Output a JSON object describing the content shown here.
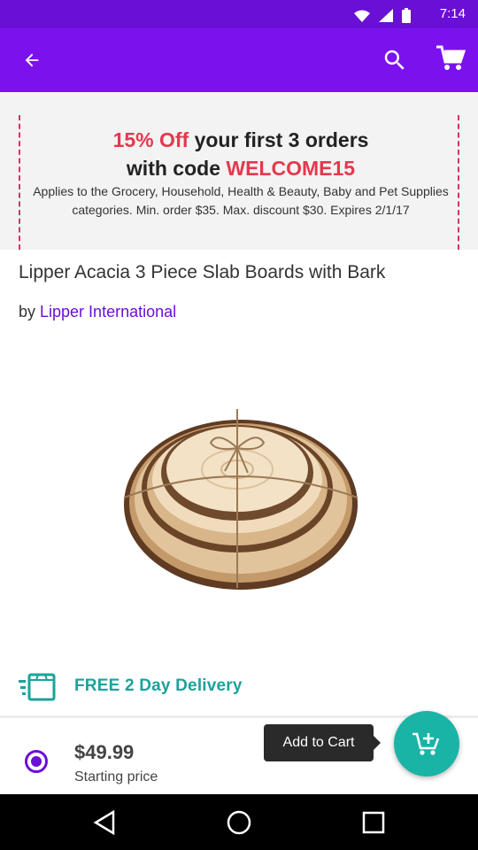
{
  "status_bar": {
    "time": "7:14"
  },
  "app_bar": {
    "back_icon": "arrow-left-icon",
    "search_icon": "search-icon",
    "cart_icon": "cart-icon"
  },
  "promo": {
    "discount": "15% Off",
    "title_part1": " your first 3 orders",
    "title_part2": "with code ",
    "code": "WELCOME15",
    "description": "Applies to the Grocery, Household, Health & Beauty, Baby and Pet Supplies categories. Min. order $35. Max. discount $30. Expires 2/1/17"
  },
  "product": {
    "title": "Lipper Acacia 3 Piece Slab Boards with Bark",
    "by_prefix": "by ",
    "brand": "Lipper International"
  },
  "delivery": {
    "label": "FREE 2 Day Delivery"
  },
  "purchase": {
    "price": "$49.99",
    "price_caption": "Starting price",
    "add_to_cart_label": "Add to Cart"
  },
  "colors": {
    "brand": "#7b12ee",
    "accent": "#19b4a6",
    "promo_highlight": "#e5384e"
  }
}
